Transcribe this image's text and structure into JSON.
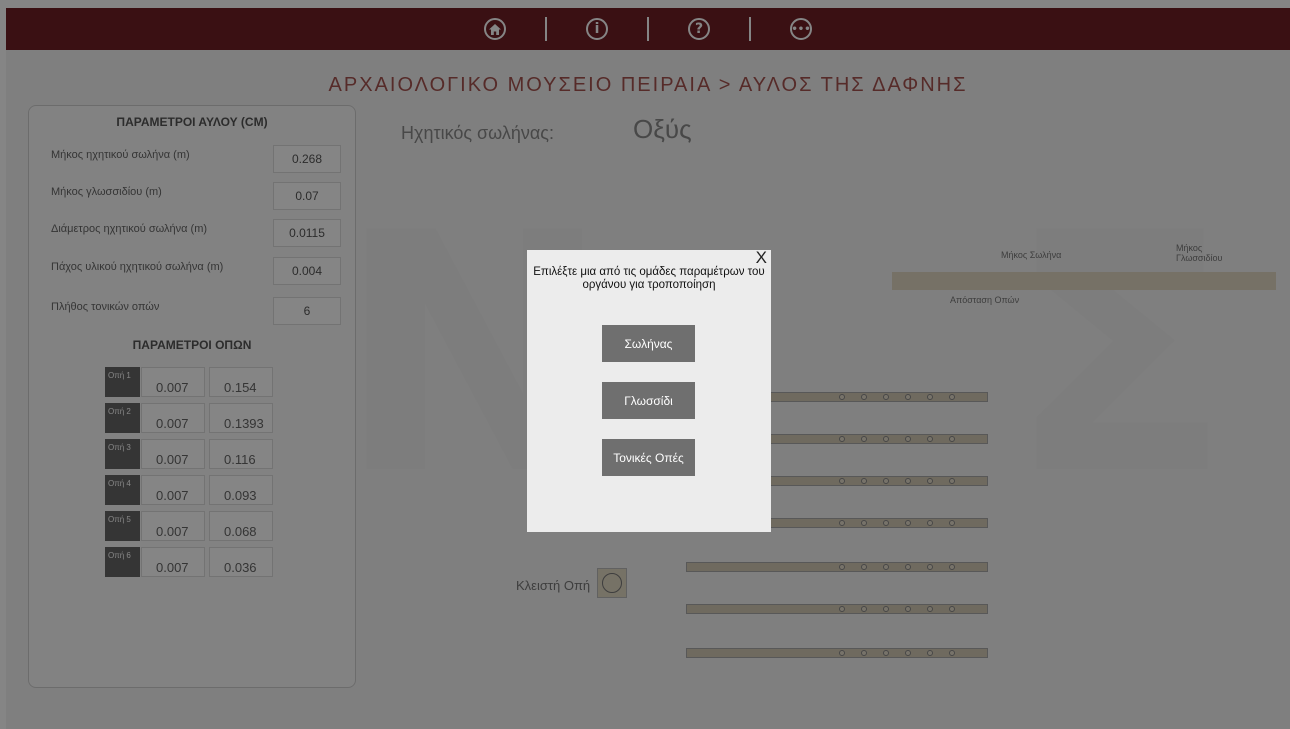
{
  "topbar": {
    "icons": [
      "home-icon",
      "info-icon",
      "help-icon",
      "more-icon"
    ],
    "color": "#6f2026"
  },
  "breadcrumb": "ΑΡΧΑΙΟΛΟΓΙΚΟ ΜΟΥΣΕΙΟ ΠΕΙΡΑΙΑ  > ΑΥΛΟΣ ΤΗΣ ΔΑΦΝΗΣ",
  "panel": {
    "title": "ΠΑΡΑΜΕΤΡΟΙ ΑΥΛΟΥ (CM)",
    "params": [
      {
        "label": "Μήκος ηχητικού σωλήνα (m)",
        "value": "0.268"
      },
      {
        "label": "Μήκος γλωσσιδίου (m)",
        "value": "0.07"
      },
      {
        "label": "Διάμετρος ηχητικού σωλήνα (m)",
        "value": "0.0115"
      },
      {
        "label": "Πάχος υλικού ηχητικού σωλήνα (m)",
        "value": "0.004"
      },
      {
        "label": "Πλήθος τονικών οπών",
        "value": "6"
      }
    ],
    "holes_title": "ΠΑΡΑΜΕΤΡΟΙ ΟΠΩΝ",
    "holes": [
      {
        "tag": "Οπή 1",
        "diameter": "0.007",
        "distance": "0.154"
      },
      {
        "tag": "Οπή 2",
        "diameter": "0.007",
        "distance": "0.1393"
      },
      {
        "tag": "Οπή 3",
        "diameter": "0.007",
        "distance": "0.116"
      },
      {
        "tag": "Οπή 4",
        "diameter": "0.007",
        "distance": "0.093"
      },
      {
        "tag": "Οπή 5",
        "diameter": "0.007",
        "distance": "0.068"
      },
      {
        "tag": "Οπή 6",
        "diameter": "0.007",
        "distance": "0.036"
      }
    ]
  },
  "tube": {
    "label": "Ηχητικός σωλήνας:",
    "value": "Οξύς"
  },
  "flute_annotations": {
    "tube_length": "Μήκος Σωλήνα",
    "reed_length": "Μήκος Γλωσσιδίου",
    "hole_distance": "Απόσταση Οπών"
  },
  "closed_hole_label": "Κλειστή Οπή",
  "modal": {
    "close": "X",
    "text": "Επιλέξτε μια από τις ομάδες παραμέτρων του οργάνου για τροποποίηση",
    "buttons": [
      "Σωλήνας",
      "Γλωσσίδι",
      "Τονικές Οπές"
    ]
  }
}
